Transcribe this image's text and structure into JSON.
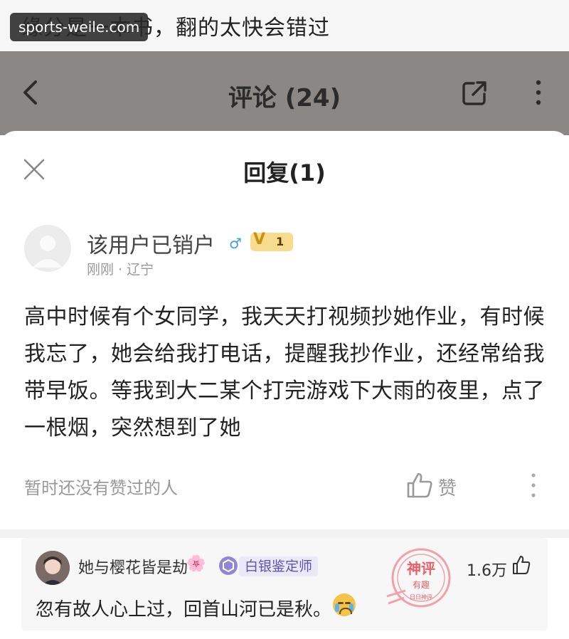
{
  "caption": {
    "text": "缘分是一本书，翻的太快会错过"
  },
  "watermark": {
    "text": "sports-weile.com"
  },
  "header": {
    "title": "评论 (24)"
  },
  "sheet": {
    "title": "回复(1)",
    "comment": {
      "username": "该用户已销户",
      "gender_icon": "male-icon",
      "level": {
        "mark": "V",
        "number": "1"
      },
      "meta": "刚刚 · 辽宁",
      "text": "高中时候有个女同学，我天天打视频抄她作业，有时候我忘了，她会给我打电话，提醒我抄作业，还经常给我带早饭。等我到大二某个打完游戏下大雨的夜里，点了一根烟，突然想到了她"
    },
    "no_likes": "暂时还没有赞过的人",
    "like_label": "赞"
  },
  "god_comment": {
    "username": "她与樱花皆是劫",
    "flower_icon": "🌸",
    "badge": "白银鉴定师",
    "like_count": "1.6万",
    "text": "忽有故人心上过，回首山河已是秋。",
    "stamp": {
      "line1": "神评",
      "line2": "有趣",
      "line3": "日日神评"
    }
  },
  "colors": {
    "accent": "#3ba0e6",
    "stamp_red": "#e8606c",
    "level_gold": "#f6dc8c",
    "badge_purple": "#5a54a8"
  }
}
